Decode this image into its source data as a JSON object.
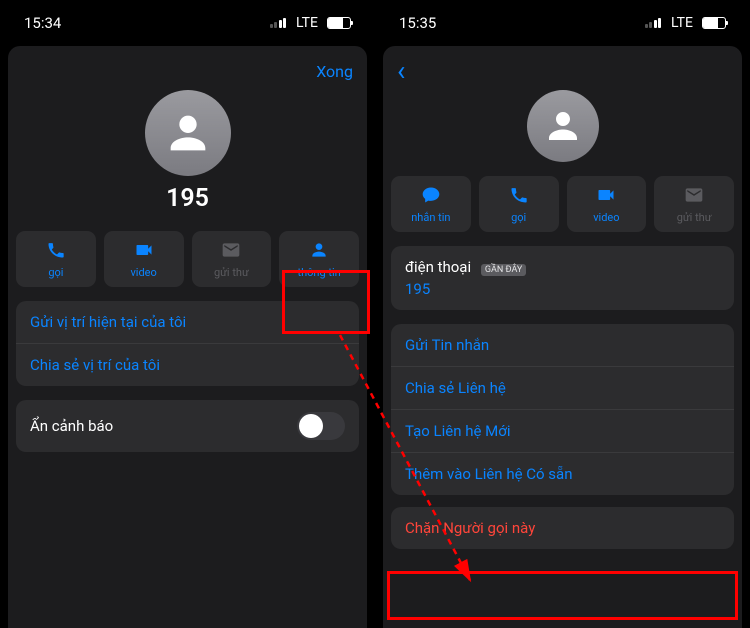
{
  "left": {
    "time": "15:34",
    "network": "LTE",
    "done": "Xong",
    "name": "195",
    "actions": [
      {
        "icon": "phone",
        "label": "gọi",
        "enabled": true
      },
      {
        "icon": "video",
        "label": "video",
        "enabled": true
      },
      {
        "icon": "mail",
        "label": "gửi thư",
        "enabled": false
      },
      {
        "icon": "info",
        "label": "thông tin",
        "enabled": true
      }
    ],
    "loc_send": "Gửi vị trí hiện tại của tôi",
    "loc_share": "Chia sẻ vị trí của tôi",
    "hide_alerts": "Ẩn cảnh báo",
    "hide_on": false
  },
  "right": {
    "time": "15:35",
    "network": "LTE",
    "actions": [
      {
        "icon": "message",
        "label": "nhắn tin",
        "enabled": true
      },
      {
        "icon": "phone",
        "label": "gọi",
        "enabled": true
      },
      {
        "icon": "video",
        "label": "video",
        "enabled": true
      },
      {
        "icon": "mail",
        "label": "gửi thư",
        "enabled": false
      }
    ],
    "phone_label": "điện thoại",
    "recent_badge": "GẦN ĐÂY",
    "phone_number": "195",
    "items": [
      {
        "text": "Gửi Tin nhắn",
        "style": "blue"
      },
      {
        "text": "Chia sẻ Liên hệ",
        "style": "blue"
      },
      {
        "text": "Tạo Liên hệ Mới",
        "style": "blue"
      },
      {
        "text": "Thêm vào Liên hệ Có sẵn",
        "style": "blue"
      }
    ],
    "block": "Chặn Người gọi này"
  }
}
